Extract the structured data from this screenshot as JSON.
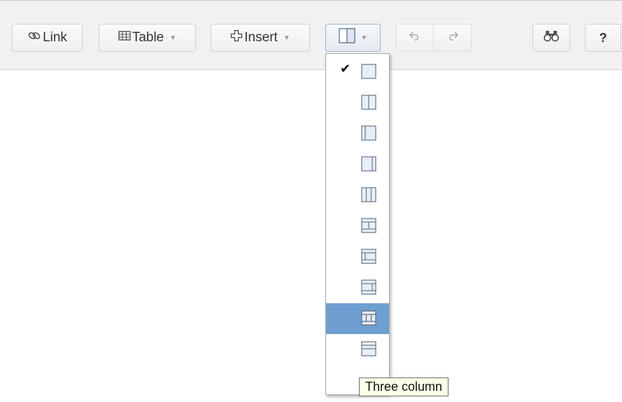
{
  "toolbar": {
    "link_label": "Link",
    "table_label": "Table",
    "insert_label": "Insert",
    "help_label": "?",
    "icons": {
      "link": "link-icon",
      "table": "table-icon",
      "insert": "plus-icon",
      "layout": "layout-icon",
      "undo": "undo-icon",
      "redo": "redo-icon",
      "find": "binoculars-icon"
    }
  },
  "layout_menu": {
    "checked_index": 0,
    "highlighted_index": 8,
    "items": [
      "one-column",
      "two-column",
      "left-sidebar",
      "right-sidebar",
      "three-column",
      "header-footer-one-column",
      "header-footer-left-sidebar",
      "header-footer-right-sidebar",
      "header-footer-three-column",
      "header-footer-more"
    ]
  },
  "tooltip": {
    "text": "Three column"
  }
}
